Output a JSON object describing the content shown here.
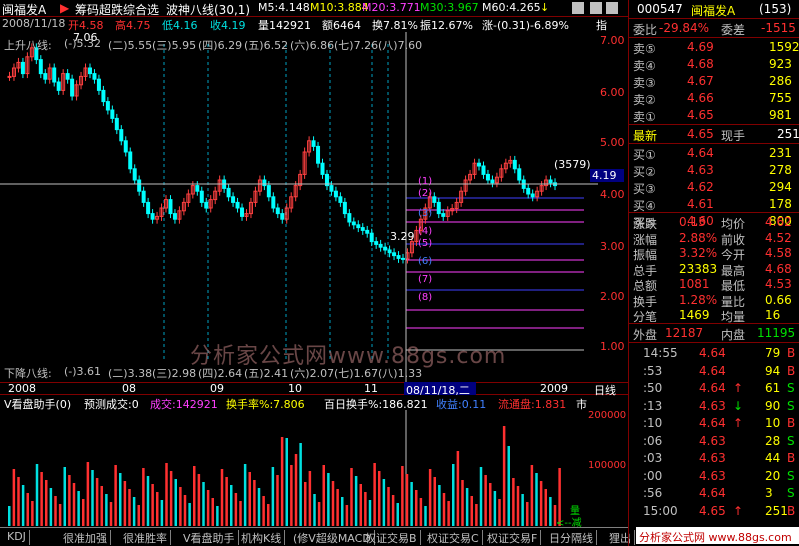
{
  "header": {
    "stock_name": "闽福发A",
    "formula1": "筹码超跌综合选",
    "formula2": "波神八线(30,1)",
    "m5": "M5:4.148",
    "m10": "M10:3.884",
    "m20": "M20:3.771",
    "m30": "M30:3.967",
    "m60": "M60:4.265",
    "arrow": "↓"
  },
  "info_row": {
    "date": "2008/11/18",
    "open": "开4.58",
    "high": "高4.75",
    "low": "低4.16",
    "close": "收4.19",
    "volume": "量142921",
    "amount": "额6464",
    "turnover": "换7.81%",
    "amplitude": "振12.67%",
    "change": "涨-(0.31)-6.89%",
    "index": "指"
  },
  "chart": {
    "up_lines_label": "上升八线:",
    "up_lines": [
      "(-)5.32",
      "(二)5.55",
      "(三)5.95",
      "(四)6.29",
      "(五)6.52",
      "(六)6.86",
      "(七)7.26",
      "(八)7.60"
    ],
    "down_lines_label": "下降八线:",
    "down_lines": [
      "(-)3.61",
      "(二)3.38",
      "(三)2.98",
      "(四)2.64",
      "(五)2.41",
      "(六)2.07",
      "(七)1.67",
      "(八)1.33"
    ],
    "peak_label": "7.06",
    "low_label": "3.29",
    "crosshair_price": "(3579)",
    "crosshair_value": "4.19",
    "circle_labels": [
      "(1)",
      "(2)",
      "(3)",
      "(4)",
      "(5)",
      "(6)",
      "(7)",
      "(8)"
    ],
    "y_ticks": [
      "7.00",
      "6.00",
      "5.00",
      "4.00",
      "3.00",
      "2.00",
      "1.00"
    ],
    "date_labels": [
      "2008",
      "08",
      "09",
      "10",
      "11",
      "2009"
    ],
    "crosshair_date": "08/11/18,二",
    "axis_unit": "日线"
  },
  "volume": {
    "title": "V看盘助手(0)",
    "forecast": "预测成交:0",
    "volume_label": "成交:142921",
    "turnover_rate": "换手率%:7.806",
    "hundred_day": "百日换手%:186.821",
    "income": "收益:0.11",
    "float": "流通盘:1.831",
    "market": "市",
    "y_ticks": [
      "200000",
      "100000"
    ],
    "legend_a": "量",
    "legend_b": "<--减"
  },
  "tabs": [
    "KDJ",
    "很准加强",
    "很准胜率",
    "V看盘助手",
    "机构K线",
    "(修V超级MACD",
    "权证交易B",
    "权证交易C",
    "权证交易F",
    "日分隔线",
    "狸出"
  ],
  "quote": {
    "code": "000547",
    "name": "闽福发A",
    "count": "(153)",
    "wei_bi_label": "委比",
    "wei_bi": "-29.84%",
    "wei_cha_label": "委差",
    "wei_cha": "-1515",
    "sells": [
      {
        "label": "卖⑤",
        "price": "4.69",
        "vol": "1592"
      },
      {
        "label": "卖④",
        "price": "4.68",
        "vol": "923"
      },
      {
        "label": "卖③",
        "price": "4.67",
        "vol": "286"
      },
      {
        "label": "卖②",
        "price": "4.66",
        "vol": "755"
      },
      {
        "label": "卖①",
        "price": "4.65",
        "vol": "981"
      }
    ],
    "latest_label": "最新",
    "latest": "4.65",
    "now_hand_label": "现手",
    "now_hand": "251",
    "buys": [
      {
        "label": "买①",
        "price": "4.64",
        "vol": "231"
      },
      {
        "label": "买②",
        "price": "4.63",
        "vol": "278"
      },
      {
        "label": "买③",
        "price": "4.62",
        "vol": "294"
      },
      {
        "label": "买④",
        "price": "4.61",
        "vol": "178"
      },
      {
        "label": "买⑤",
        "price": "4.60",
        "vol": "800"
      }
    ],
    "stats": [
      {
        "l1": "涨跌",
        "v1": "0.13",
        "l2": "均价",
        "v2": "4.62"
      },
      {
        "l1": "涨幅",
        "v1": "2.88%",
        "l2": "前收",
        "v2": "4.52"
      },
      {
        "l1": "振幅",
        "v1": "3.32%",
        "l2": "今开",
        "v2": "4.58"
      },
      {
        "l1": "总手",
        "v1": "23383",
        "l2": "最高",
        "v2": "4.68"
      },
      {
        "l1": "总额",
        "v1": "1081",
        "l2": "最低",
        "v2": "4.53"
      },
      {
        "l1": "换手",
        "v1": "1.28%",
        "l2": "量比",
        "v2": "0.66"
      },
      {
        "l1": "分笔",
        "v1": "1469",
        "l2": "均量",
        "v2": "16"
      }
    ],
    "outer_label": "外盘",
    "outer": "12187",
    "inner_label": "内盘",
    "inner": "11195",
    "ticks": [
      {
        "t": "14:55",
        "p": "4.64",
        "a": "",
        "v": "79",
        "s": "B"
      },
      {
        "t": ":53",
        "p": "4.64",
        "a": "",
        "v": "94",
        "s": "B"
      },
      {
        "t": ":50",
        "p": "4.64",
        "a": "↑",
        "v": "61",
        "s": "S"
      },
      {
        "t": ":13",
        "p": "4.63",
        "a": "↓",
        "v": "90",
        "s": "S"
      },
      {
        "t": ":10",
        "p": "4.64",
        "a": "↑",
        "v": "10",
        "s": "B"
      },
      {
        "t": ":06",
        "p": "4.63",
        "a": "",
        "v": "28",
        "s": "S"
      },
      {
        "t": ":03",
        "p": "4.63",
        "a": "",
        "v": "44",
        "s": "B"
      },
      {
        "t": ":00",
        "p": "4.63",
        "a": "",
        "v": "20",
        "s": "S"
      },
      {
        "t": ":56",
        "p": "4.64",
        "a": "",
        "v": "3",
        "s": "S"
      },
      {
        "t": "15:00",
        "p": "4.65",
        "a": "↑",
        "v": "251",
        "s": "B"
      }
    ]
  },
  "watermark": "分析家公式网www.88gs.com",
  "watermark_footer": "分析家公式网 www.88gs.com"
}
